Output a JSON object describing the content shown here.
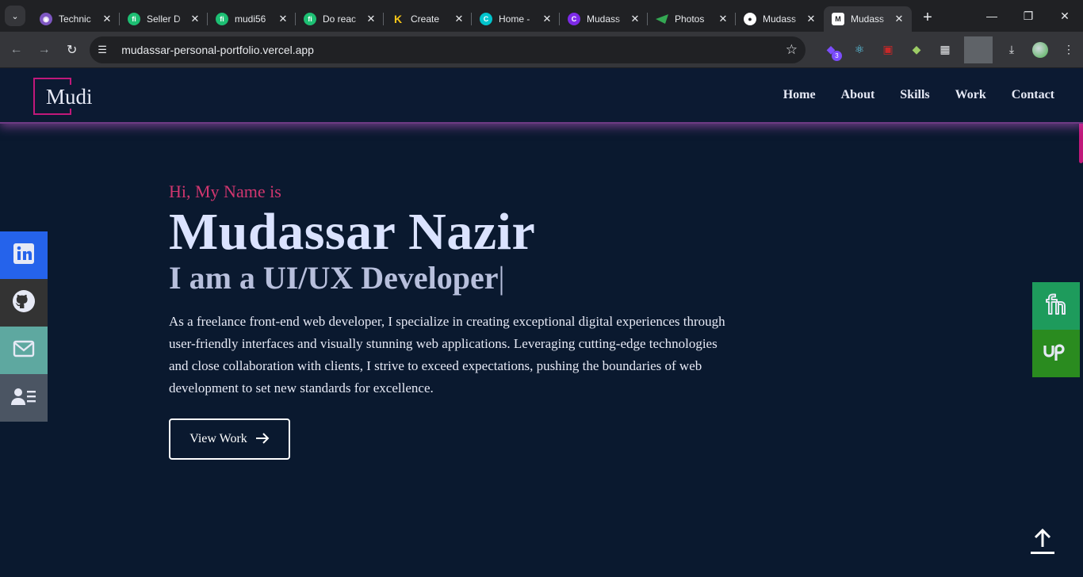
{
  "browser": {
    "tabs": [
      {
        "title": "Technic",
        "icon": "app-icon",
        "color": "#7e57c2"
      },
      {
        "title": "Seller D",
        "icon": "fiverr-icon",
        "color": "#1dbf73"
      },
      {
        "title": "mudi56",
        "icon": "fiverr-icon",
        "color": "#1dbf73"
      },
      {
        "title": "Do reac",
        "icon": "fiverr-icon",
        "color": "#1dbf73"
      },
      {
        "title": "Create",
        "icon": "k-icon",
        "color": "#f5c518"
      },
      {
        "title": "Home -",
        "icon": "canva-icon",
        "color": "#00c4cc"
      },
      {
        "title": "Mudass",
        "icon": "canva-icon",
        "color": "#7d2ae8"
      },
      {
        "title": "Photos",
        "icon": "photos-icon",
        "color": "#34a853"
      },
      {
        "title": "Mudass",
        "icon": "github-icon",
        "color": "#ffffff"
      },
      {
        "title": "Mudass",
        "icon": "m-icon",
        "color": "#ffffff"
      }
    ],
    "url": "mudassar-personal-portfolio.vercel.app",
    "extension_badge": "3"
  },
  "site": {
    "logo": "Mudi",
    "nav": [
      "Home",
      "About",
      "Skills",
      "Work",
      "Contact"
    ],
    "greeting": "Hi, My Name is",
    "name": "Mudassar Nazir",
    "role": "I am a UI/UX Developer",
    "role_cursor": "|",
    "about": "As a freelance front-end web developer, I specialize in creating exceptional digital experiences through user-friendly interfaces and visually stunning web applications. Leveraging cutting-edge technologies and close collaboration with clients, I strive to exceed expectations, pushing the boundaries of web development to set new standards for excellence.",
    "cta_label": "View Work"
  },
  "colors": {
    "background": "#0a192f",
    "accent": "#c0187a",
    "greeting": "#d1366f",
    "linkedin": "#2563eb",
    "github": "#333333",
    "email": "#5ea8a0",
    "resume": "#4b5563",
    "fiverr": "#1e9b5c",
    "upwork": "#2a8b1f"
  },
  "social_links": [
    "linkedin-icon",
    "github-icon",
    "mail-icon",
    "resume-icon"
  ],
  "hire_links": [
    "fiverr-icon",
    "upwork-icon"
  ]
}
